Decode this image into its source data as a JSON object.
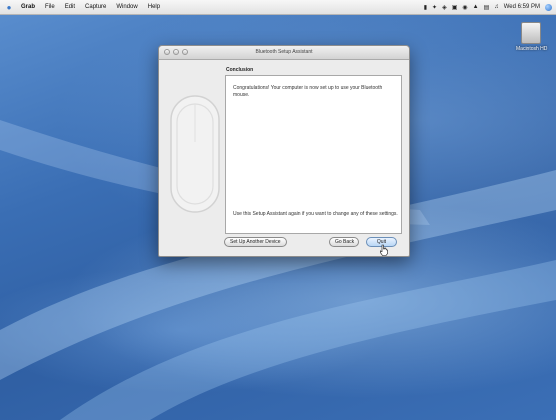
{
  "menubar": {
    "app_name": "Grab",
    "items": [
      "File",
      "Edit",
      "Capture",
      "Window",
      "Help"
    ],
    "clock": "Wed 6:59 PM"
  },
  "desktop": {
    "hd_label": "Macintosh HD"
  },
  "window": {
    "title": "Bluetooth Setup Assistant",
    "heading": "Conclusion",
    "message": "Congratulations! Your computer is now set up to use your Bluetooth mouse.",
    "hint": "Use this Setup Assistant again if you want to change any of these settings.",
    "buttons": {
      "set_up_another": "Set Up Another Device",
      "go_back": "Go Back",
      "quit": "Quit"
    }
  },
  "colors": {
    "desktop_blue": "#3a6eb4",
    "default_button": "#b9d6f5"
  }
}
